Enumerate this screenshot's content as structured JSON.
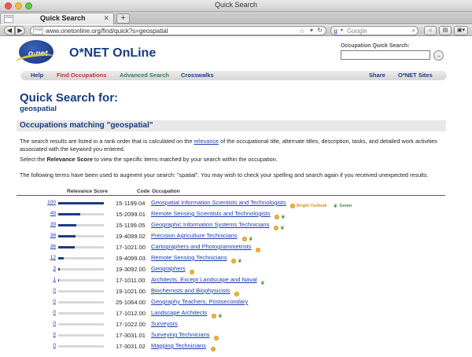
{
  "browser": {
    "window_title": "Quick Search",
    "tab_title": "Quick Search",
    "tab_favicon_text": "o*net",
    "new_tab_label": "+",
    "url": "www.onetonline.org/find/quick?s=geospatial",
    "search_placeholder": "Google"
  },
  "header": {
    "logo_text": "o·net",
    "site_title": "O*NET OnLine",
    "quick_search_label": "Occupation Quick Search:",
    "quick_search_value": ""
  },
  "menu": {
    "help": "Help",
    "find": "Find Occupations",
    "advanced": "Advanced Search",
    "crosswalks": "Crosswalks",
    "share": "Share",
    "sites": "O*NET Sites"
  },
  "main": {
    "title": "Quick Search for:",
    "term": "geospatial",
    "section_title": "Occupations matching \"geospatial\"",
    "p1_a": "The search results are listed in a rank order that is calculated on the ",
    "p1_link": "relevance",
    "p1_b": " of the occupational title, alternate titles, description, tasks, and detailed work activities associated with the keyword you entered.",
    "p2_a": "Select the ",
    "p2_bold": "Relevance Score",
    "p2_b": " to view the specific items matched by your search within the occupation.",
    "p3": "The following terms have been used to augment your search: \"spatial\". You may wish to check your spelling and search again if you received unexpected results."
  },
  "table": {
    "headers": {
      "relevance": "Relevance Score",
      "code": "Code",
      "occupation": "Occupation"
    },
    "legend": {
      "bright": "Bright Outlook",
      "green": "Green"
    },
    "rows": [
      {
        "score": "100",
        "pct": 1.0,
        "code": "15-1199.04",
        "title": "Geospatial Information Scientists and Technologists",
        "bright": true,
        "green": true,
        "legend": true
      },
      {
        "score": "49",
        "pct": 0.49,
        "code": "15-2099.01",
        "title": "Remote Sensing Scientists and Technologists",
        "bright": true,
        "green": true
      },
      {
        "score": "39",
        "pct": 0.39,
        "code": "15-1199.05",
        "title": "Geographic Information Systems Technicians",
        "bright": true,
        "green": true
      },
      {
        "score": "38",
        "pct": 0.38,
        "code": "19-4099.02",
        "title": "Precision Agriculture Technicians",
        "bright": true,
        "green": true
      },
      {
        "score": "36",
        "pct": 0.36,
        "code": "17-1021.00",
        "title": "Cartographers and Photogrammetrists",
        "bright": true,
        "green": false
      },
      {
        "score": "12",
        "pct": 0.12,
        "code": "19-4099.03",
        "title": "Remote Sensing Technicians",
        "bright": true,
        "green": true
      },
      {
        "score": "3",
        "pct": 0.03,
        "code": "19-3092.00",
        "title": "Geographers",
        "bright": true,
        "green": false
      },
      {
        "score": "1",
        "pct": 0.01,
        "code": "17-1011.00",
        "title": "Architects, Except Landscape and Naval",
        "bright": false,
        "green": true
      },
      {
        "score": "0",
        "pct": 0.0,
        "code": "19-1021.00",
        "title": "Biochemists and Biophysicists",
        "bright": true,
        "green": false
      },
      {
        "score": "0",
        "pct": 0.0,
        "code": "25-1064.00",
        "title": "Geography Teachers, Postsecondary",
        "bright": false,
        "green": false
      },
      {
        "score": "0",
        "pct": 0.0,
        "code": "17-1012.00",
        "title": "Landscape Architects",
        "bright": true,
        "green": true
      },
      {
        "score": "0",
        "pct": 0.0,
        "code": "17-1022.00",
        "title": "Surveyors",
        "bright": false,
        "green": false
      },
      {
        "score": "0",
        "pct": 0.0,
        "code": "17-3031.01",
        "title": "Surveying Technicians",
        "bright": true,
        "green": false
      },
      {
        "score": "0",
        "pct": 0.0,
        "code": "17-3031.02",
        "title": "Mapping Technicians",
        "bright": true,
        "green": false
      }
    ]
  }
}
